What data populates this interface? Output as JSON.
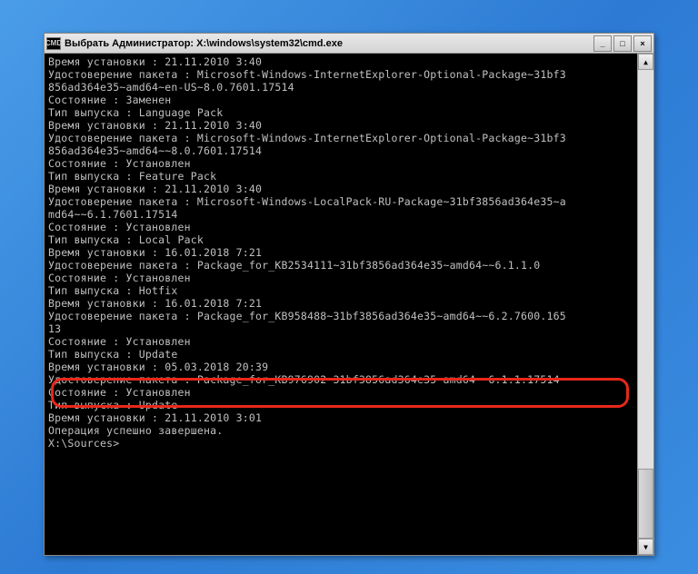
{
  "window": {
    "title": "Выбрать Администратор: X:\\windows\\system32\\cmd.exe",
    "icon_label": "CMD"
  },
  "controls": {
    "minimize": "_",
    "maximize": "□",
    "close": "×"
  },
  "scroll": {
    "up": "▲",
    "down": "▼"
  },
  "terminal_lines": [
    "Время установки : 21.11.2010 3:40",
    "",
    "Удостоверение пакета : Microsoft-Windows-InternetExplorer-Optional-Package~31bf3",
    "856ad364e35~amd64~en-US~8.0.7601.17514",
    "Состояние : Заменен",
    "Тип выпуска : Language Pack",
    "Время установки : 21.11.2010 3:40",
    "",
    "Удостоверение пакета : Microsoft-Windows-InternetExplorer-Optional-Package~31bf3",
    "856ad364e35~amd64~~8.0.7601.17514",
    "Состояние : Установлен",
    "Тип выпуска : Feature Pack",
    "Время установки : 21.11.2010 3:40",
    "",
    "Удостоверение пакета : Microsoft-Windows-LocalPack-RU-Package~31bf3856ad364e35~a",
    "md64~~6.1.7601.17514",
    "Состояние : Установлен",
    "Тип выпуска : Local Pack",
    "Время установки : 16.01.2018 7:21",
    "",
    "Удостоверение пакета : Package_for_KB2534111~31bf3856ad364e35~amd64~~6.1.1.0",
    "Состояние : Установлен",
    "Тип выпуска : Hotfix",
    "Время установки : 16.01.2018 7:21",
    "",
    "Удостоверение пакета : Package_for_KB958488~31bf3856ad364e35~amd64~~6.2.7600.165",
    "13",
    "Состояние : Установлен",
    "Тип выпуска : Update",
    "Время установки : 05.03.2018 20:39",
    "",
    "Удостоверение пакета : Package_for_KB976902~31bf3856ad364e35~amd64~~6.1.1.17514",
    "Состояние : Установлен",
    "Тип выпуска : Update",
    "Время установки : 21.11.2010 3:01",
    "",
    "Операция успешно завершена.",
    "",
    "X:\\Sources>"
  ],
  "highlighted_line_index": 25
}
